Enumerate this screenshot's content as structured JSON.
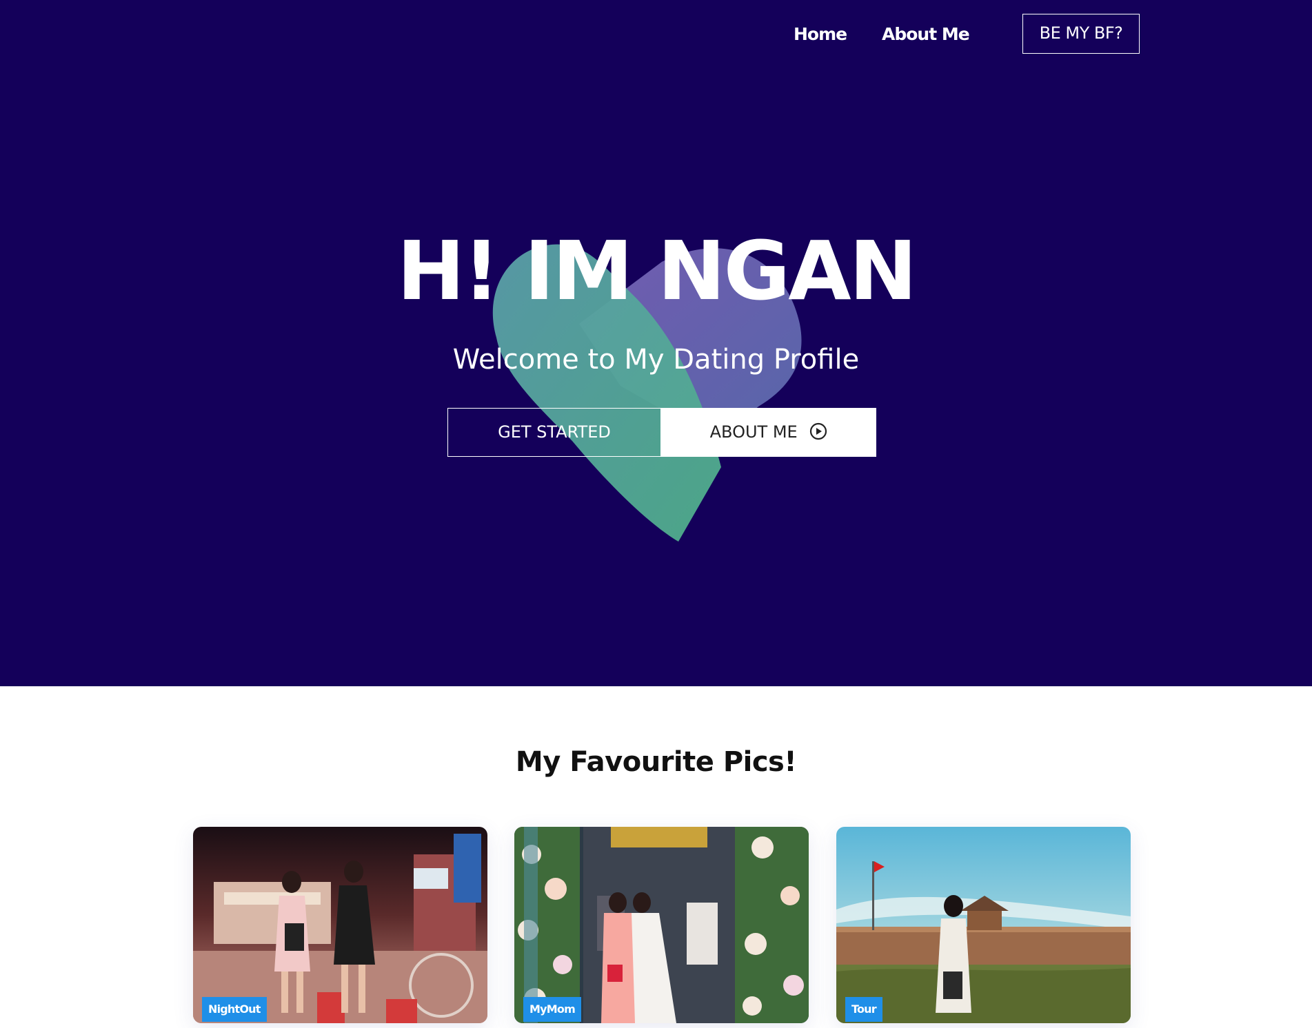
{
  "nav": {
    "home_label": "Home",
    "about_label": "About Me",
    "cta_label": "BE MY BF?"
  },
  "hero": {
    "title": "H! IM NGAN",
    "subtitle": "Welcome to My Dating Profile",
    "primary_button_label": "GET STARTED",
    "secondary_button_label": "ABOUT ME",
    "secondary_button_icon": "play-circle-icon"
  },
  "gallery": {
    "title": "My Favourite Pics!",
    "cards": [
      {
        "tag": "NightOut"
      },
      {
        "tag": "MyMom"
      },
      {
        "tag": "Tour"
      }
    ]
  },
  "colors": {
    "hero_background": "#14005a",
    "heart_left": "#4fa8a8",
    "heart_right": "#6b5fb0",
    "tag_background": "#1f8fe8"
  }
}
